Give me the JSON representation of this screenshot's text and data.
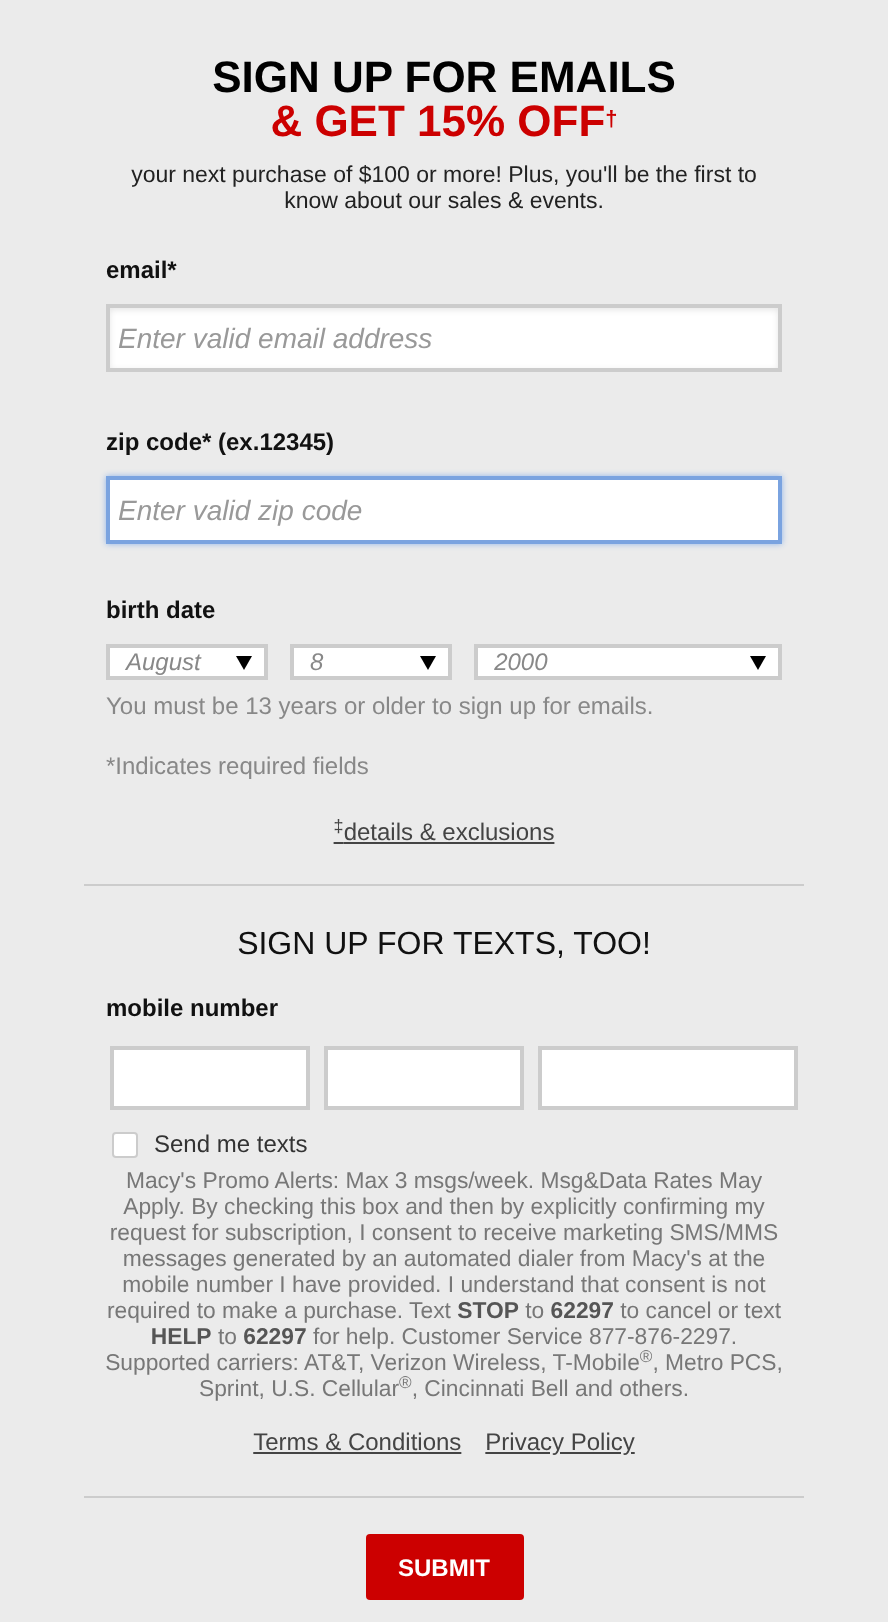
{
  "email_signup": {
    "title": "SIGN UP FOR EMAILS",
    "offer": "& GET 15% OFF$^{†}$",
    "intro": "your next purchase of $100 or more! Plus, you'll be the first to know about our sales & events.",
    "fields": [
      {
        "label": "email*",
        "placeholder": "Enter valid email address",
        "focused": false
      },
      {
        "label": "zip code* (ex.12345)",
        "placeholder": "Enter valid zip code",
        "focused": true
      }
    ],
    "birth_date": {
      "label": "birth date",
      "selects": [
        "August",
        "8",
        "2000"
      ],
      "note": "You must be 13 years or older to sign up for emails."
    },
    "required_note": "*Indicates required fields",
    "details_link": "$^{‡}$details & exclusions"
  },
  "text_signup": {
    "title": "SIGN UP FOR TEXTS, TOO!",
    "mobile_label": "mobile number",
    "checkbox": {
      "label": "Send me texts",
      "checked": false
    },
    "disclaimer": "Macy's Promo Alerts: Max 3 msgs/week. Msg&Data Rates May Apply. By checking this box and then by explicitly confirming my request for subscription, I consent to receive marketing SMS/MMS messages generated by an automated dialer from Macy's at the mobile number I have provided. I understand that consent is not required to make a purchase. Text **STOP** to **62297** to cancel or text **HELP** to **62297** for help. Customer Service 877-876-2297. Supported carriers: AT&T, Verizon Wireless, T-Mobile$^{®}$, Metro PCS, Sprint, U.S. Cellular$^{®}$, Cincinnati Bell and others.",
    "links": [
      "Terms & Conditions",
      "Privacy Policy"
    ]
  },
  "submit": "SUBMIT"
}
